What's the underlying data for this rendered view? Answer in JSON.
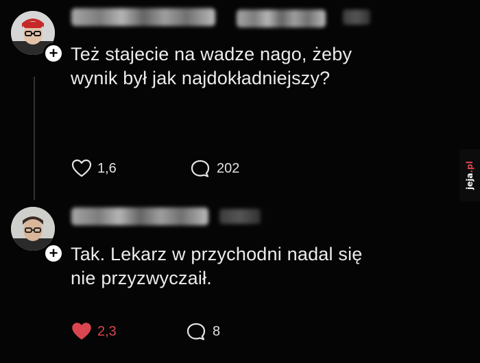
{
  "posts": [
    {
      "text_line1": "Też stajecie na wadze nago, żeby",
      "text_line2": "wynik był jak najdokładniejszy?",
      "likes": "1,6",
      "comments": "202",
      "liked": false
    },
    {
      "text_line1": "Tak. Lekarz w przychodni nadal się",
      "text_line2": "nie przyzwyczaił.",
      "likes": "2,3",
      "comments": "8",
      "liked": true
    }
  ],
  "follow_badge_symbol": "+",
  "watermark": {
    "brand": "jeja",
    "suffix": ".pl"
  },
  "colors": {
    "background": "#050505",
    "like_active": "#d9464f",
    "text": "#ececec"
  },
  "icons": [
    "avatar",
    "plus-icon",
    "heart-icon",
    "comment-icon"
  ]
}
